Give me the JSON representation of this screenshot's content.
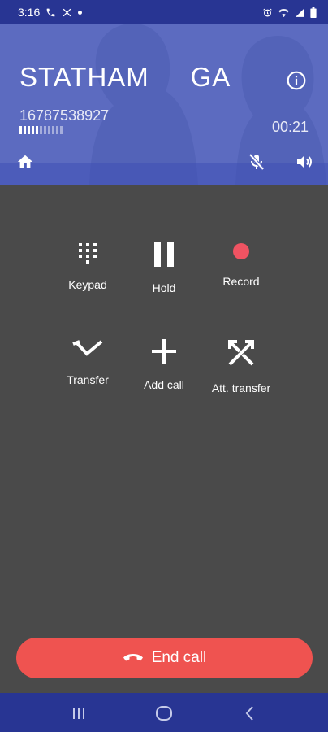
{
  "status_bar": {
    "time": "3:16",
    "icons": [
      "phone-call-icon",
      "missed-call-icon",
      "notification-dot-icon",
      "alarm-icon",
      "wifi-icon",
      "cell-signal-icon",
      "battery-icon"
    ]
  },
  "call": {
    "contact_name": "STATHAM     GA",
    "number": "16787538927",
    "duration": "00:21",
    "header_color": "#5c6bc0"
  },
  "actions": [
    {
      "label": "Keypad",
      "icon": "keypad-icon"
    },
    {
      "label": "Hold",
      "icon": "pause-icon"
    },
    {
      "label": "Record",
      "icon": "record-icon"
    },
    {
      "label": "Transfer",
      "icon": "transfer-icon"
    },
    {
      "label": "Add call",
      "icon": "plus-icon"
    },
    {
      "label": "Att. transfer",
      "icon": "attended-transfer-icon"
    }
  ],
  "end_call": {
    "label": "End call",
    "color": "#ef5350"
  },
  "nav": {
    "icons": [
      "recents-icon",
      "home-circle-icon",
      "back-icon"
    ],
    "color": "#283593"
  }
}
